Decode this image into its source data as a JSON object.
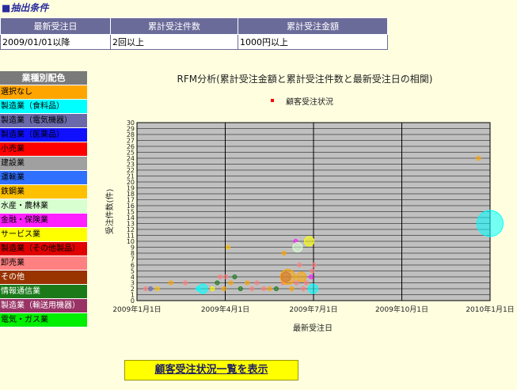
{
  "section_title": "■抽出条件",
  "conditions": {
    "headers": [
      "最新受注日",
      "累計受注件数",
      "累計受注金額"
    ],
    "values": [
      "2009/01/01以降",
      "2回以上",
      "1000円以上"
    ]
  },
  "legend": {
    "title": "業種別配色",
    "items": [
      {
        "label": "選択なし",
        "bg": "#ffa500",
        "fg": "#000000"
      },
      {
        "label": "製造業（食料品）",
        "bg": "#00ffff",
        "fg": "#000000"
      },
      {
        "label": "製造業（電気機器）",
        "bg": "#6a6aaa",
        "fg": "#000000"
      },
      {
        "label": "製造業（医薬品）",
        "bg": "#1010ff",
        "fg": "#000000"
      },
      {
        "label": "小売業",
        "bg": "#ff0000",
        "fg": "#000000"
      },
      {
        "label": "建設業",
        "bg": "#a0a0a0",
        "fg": "#000000"
      },
      {
        "label": "運輸業",
        "bg": "#3070ff",
        "fg": "#000000"
      },
      {
        "label": "鉄鋼業",
        "bg": "#ffc000",
        "fg": "#000000"
      },
      {
        "label": "水産・農林業",
        "bg": "#d8ffd0",
        "fg": "#000000"
      },
      {
        "label": "金融・保険業",
        "bg": "#ff20ff",
        "fg": "#000000"
      },
      {
        "label": "サービス業",
        "bg": "#ffff00",
        "fg": "#000000"
      },
      {
        "label": "製造業（その他製品）",
        "bg": "#e00000",
        "fg": "#000000"
      },
      {
        "label": "卸売業",
        "bg": "#ff8080",
        "fg": "#000000"
      },
      {
        "label": "その他",
        "bg": "#993300",
        "fg": "#ffffff"
      },
      {
        "label": "情報通信業",
        "bg": "#1a7a1a",
        "fg": "#ffffff"
      },
      {
        "label": "製造業（輸送用機器）",
        "bg": "#993366",
        "fg": "#ffffff"
      },
      {
        "label": "電気・ガス業",
        "bg": "#00ee00",
        "fg": "#000000"
      }
    ]
  },
  "show_button": "顧客受注状況一覧を表示",
  "chart_data": {
    "type": "scatter",
    "title": "RFM分析(累計受注金額と累計受注件数と最新受注日の相関)",
    "legend_label": "顧客受注状況",
    "legend_color": "#ff0000",
    "legend_position": "top",
    "xlabel": "最新受注日",
    "ylabel": "受注件数(件)",
    "x_ticks": [
      "2009年1月1日",
      "2009年4月1日",
      "2009年7月1日",
      "2009年10月1日",
      "2010年1月1日"
    ],
    "x_range": [
      "2009-01-01",
      "2010-01-01"
    ],
    "ylim": [
      0,
      30
    ],
    "grid": true,
    "plot_bg": "#c0c0c0",
    "points": [
      {
        "date": "2009-01-10",
        "y": 2,
        "size": 1,
        "color": "#ff8080"
      },
      {
        "date": "2009-01-15",
        "y": 2,
        "size": 1,
        "color": "#6a6aaa"
      },
      {
        "date": "2009-01-22",
        "y": 2,
        "size": 1,
        "color": "#ffc000"
      },
      {
        "date": "2009-02-05",
        "y": 3,
        "size": 1,
        "color": "#ffa500"
      },
      {
        "date": "2009-02-20",
        "y": 3,
        "size": 1,
        "color": "#ff8080"
      },
      {
        "date": "2009-03-05",
        "y": 2,
        "size": 1,
        "color": "#00ffff"
      },
      {
        "date": "2009-03-10",
        "y": 2,
        "size": 2,
        "color": "#00ffff"
      },
      {
        "date": "2009-03-20",
        "y": 2,
        "size": 1,
        "color": "#ffff00"
      },
      {
        "date": "2009-03-25",
        "y": 3,
        "size": 1,
        "color": "#1a7a1a"
      },
      {
        "date": "2009-03-28",
        "y": 4,
        "size": 1,
        "color": "#ff8080"
      },
      {
        "date": "2009-04-01",
        "y": 2,
        "size": 1,
        "color": "#ffa500"
      },
      {
        "date": "2009-04-03",
        "y": 4,
        "size": 1,
        "color": "#ff8080"
      },
      {
        "date": "2009-04-05",
        "y": 9,
        "size": 1,
        "color": "#ffc000"
      },
      {
        "date": "2009-04-08",
        "y": 3,
        "size": 1,
        "color": "#ffa500"
      },
      {
        "date": "2009-04-12",
        "y": 4,
        "size": 1,
        "color": "#1a7a1a"
      },
      {
        "date": "2009-04-18",
        "y": 2,
        "size": 1,
        "color": "#1a7a1a"
      },
      {
        "date": "2009-04-25",
        "y": 3,
        "size": 1,
        "color": "#ffa500"
      },
      {
        "date": "2009-04-30",
        "y": 2,
        "size": 1,
        "color": "#ff8080"
      },
      {
        "date": "2009-05-05",
        "y": 3,
        "size": 1,
        "color": "#ff8080"
      },
      {
        "date": "2009-05-12",
        "y": 2,
        "size": 1,
        "color": "#ff8080"
      },
      {
        "date": "2009-05-18",
        "y": 2,
        "size": 1,
        "color": "#ffa500"
      },
      {
        "date": "2009-05-25",
        "y": 2,
        "size": 1,
        "color": "#1a7a1a"
      },
      {
        "date": "2009-06-01",
        "y": 3,
        "size": 1,
        "color": "#ff8080"
      },
      {
        "date": "2009-06-02",
        "y": 8,
        "size": 1,
        "color": "#ffa500"
      },
      {
        "date": "2009-06-04",
        "y": 4,
        "size": 2,
        "color": "#993366"
      },
      {
        "date": "2009-06-06",
        "y": 4,
        "size": 3,
        "color": "#ffa500"
      },
      {
        "date": "2009-06-10",
        "y": 2,
        "size": 1,
        "color": "#ffa500"
      },
      {
        "date": "2009-06-14",
        "y": 10,
        "size": 1,
        "color": "#ff20ff"
      },
      {
        "date": "2009-06-15",
        "y": 3,
        "size": 1,
        "color": "#ff8080"
      },
      {
        "date": "2009-06-16",
        "y": 9,
        "size": 2,
        "color": "#d8ffd0"
      },
      {
        "date": "2009-06-18",
        "y": 6,
        "size": 1,
        "color": "#ff8080"
      },
      {
        "date": "2009-06-20",
        "y": 4,
        "size": 2,
        "color": "#ffa500"
      },
      {
        "date": "2009-06-22",
        "y": 2,
        "size": 1,
        "color": "#ff8080"
      },
      {
        "date": "2009-06-25",
        "y": 3,
        "size": 1,
        "color": "#ff8080"
      },
      {
        "date": "2009-06-28",
        "y": 10,
        "size": 2,
        "color": "#ffff00"
      },
      {
        "date": "2009-06-30",
        "y": 4,
        "size": 1,
        "color": "#ff20ff"
      },
      {
        "date": "2009-07-01",
        "y": 5,
        "size": 1,
        "color": "#ff8080"
      },
      {
        "date": "2009-07-02",
        "y": 2,
        "size": 2,
        "color": "#00ffff"
      },
      {
        "date": "2009-07-03",
        "y": 6,
        "size": 1,
        "color": "#ff8080"
      },
      {
        "date": "2009-12-20",
        "y": 24,
        "size": 1,
        "color": "#ffa500"
      },
      {
        "date": "2010-01-01",
        "y": 13,
        "size": 5,
        "color": "#00ffff"
      }
    ]
  }
}
